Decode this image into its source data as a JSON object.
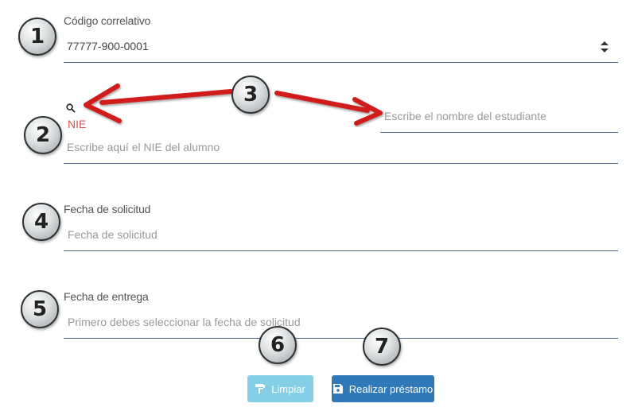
{
  "form": {
    "codigo": {
      "label": "Código correlativo",
      "value": "77777-900-0001"
    },
    "nie": {
      "label": "NIE",
      "placeholder": "Escribe aquí el NIE del alumno",
      "search_placeholder": "Escribe el nombre del estudiante"
    },
    "fecha_solicitud": {
      "label": "Fecha de solicitud",
      "placeholder": "Fecha de solicitud"
    },
    "fecha_entrega": {
      "label": "Fecha de entrega",
      "placeholder": "Primero debes seleccionar la fecha de solicitud"
    }
  },
  "buttons": {
    "limpiar": "Limpiar",
    "realizar": "Realizar préstamo"
  },
  "annotations": [
    "1",
    "2",
    "3",
    "4",
    "5",
    "6",
    "7"
  ],
  "colors": {
    "underline": "#4a5f85",
    "nie_label": "#d9534f",
    "btn_limpiar": "#5bc0de",
    "btn_realizar": "#2f79b9",
    "arrow": "#d11a1a"
  },
  "icons": [
    "search-icon",
    "sort-icon",
    "paint-roller-icon",
    "floppy-disk-icon"
  ]
}
